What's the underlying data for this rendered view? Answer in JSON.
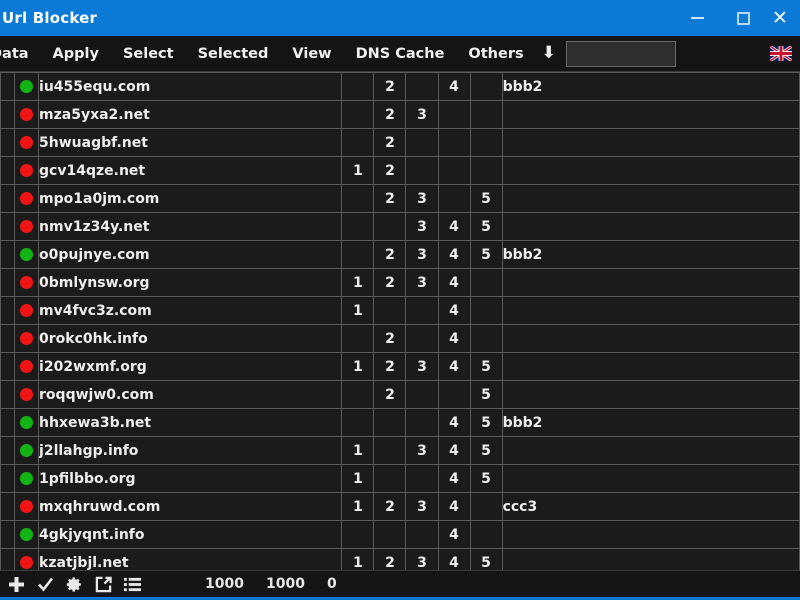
{
  "window": {
    "title": "Url Blocker",
    "controls": {
      "minimize": "—",
      "maximize": "□",
      "close": "✕"
    }
  },
  "menubar": {
    "items": [
      {
        "label": "Data"
      },
      {
        "label": "Apply"
      },
      {
        "label": "Select"
      },
      {
        "label": "Selected"
      },
      {
        "label": "View"
      },
      {
        "label": "DNS Cache"
      },
      {
        "label": "Others"
      }
    ],
    "arrow": "⬇",
    "search": {
      "value": "",
      "placeholder": ""
    },
    "flag_icon": "uk-flag-icon"
  },
  "table": {
    "columns": [
      "status",
      "domain",
      "col1",
      "col2",
      "col3",
      "col4",
      "col5",
      "tag"
    ],
    "rows": [
      {
        "status": "green",
        "domain": "iu455equ.com",
        "c1": "",
        "c2": "2",
        "c3": "",
        "c4": "4",
        "c5": "",
        "tag": "bbb2"
      },
      {
        "status": "red",
        "domain": "mza5yxa2.net",
        "c1": "",
        "c2": "2",
        "c3": "3",
        "c4": "",
        "c5": "",
        "tag": ""
      },
      {
        "status": "red",
        "domain": "5hwuagbf.net",
        "c1": "",
        "c2": "2",
        "c3": "",
        "c4": "",
        "c5": "",
        "tag": ""
      },
      {
        "status": "red",
        "domain": "gcv14qze.net",
        "c1": "1",
        "c2": "2",
        "c3": "",
        "c4": "",
        "c5": "",
        "tag": ""
      },
      {
        "status": "red",
        "domain": "mpo1a0jm.com",
        "c1": "",
        "c2": "2",
        "c3": "3",
        "c4": "",
        "c5": "5",
        "tag": ""
      },
      {
        "status": "red",
        "domain": "nmv1z34y.net",
        "c1": "",
        "c2": "",
        "c3": "3",
        "c4": "4",
        "c5": "5",
        "tag": ""
      },
      {
        "status": "green",
        "domain": "o0pujnye.com",
        "c1": "",
        "c2": "2",
        "c3": "3",
        "c4": "4",
        "c5": "5",
        "tag": "bbb2"
      },
      {
        "status": "red",
        "domain": "0bmlynsw.org",
        "c1": "1",
        "c2": "2",
        "c3": "3",
        "c4": "4",
        "c5": "",
        "tag": ""
      },
      {
        "status": "red",
        "domain": "mv4fvc3z.com",
        "c1": "1",
        "c2": "",
        "c3": "",
        "c4": "4",
        "c5": "",
        "tag": ""
      },
      {
        "status": "red",
        "domain": "0rokc0hk.info",
        "c1": "",
        "c2": "2",
        "c3": "",
        "c4": "4",
        "c5": "",
        "tag": ""
      },
      {
        "status": "red",
        "domain": "i202wxmf.org",
        "c1": "1",
        "c2": "2",
        "c3": "3",
        "c4": "4",
        "c5": "5",
        "tag": ""
      },
      {
        "status": "red",
        "domain": "roqqwjw0.com",
        "c1": "",
        "c2": "2",
        "c3": "",
        "c4": "",
        "c5": "5",
        "tag": ""
      },
      {
        "status": "green",
        "domain": "hhxewa3b.net",
        "c1": "",
        "c2": "",
        "c3": "",
        "c4": "4",
        "c5": "5",
        "tag": "bbb2"
      },
      {
        "status": "green",
        "domain": "j2llahgp.info",
        "c1": "1",
        "c2": "",
        "c3": "3",
        "c4": "4",
        "c5": "5",
        "tag": ""
      },
      {
        "status": "green",
        "domain": "1pfilbbo.org",
        "c1": "1",
        "c2": "",
        "c3": "",
        "c4": "4",
        "c5": "5",
        "tag": ""
      },
      {
        "status": "red",
        "domain": "mxqhruwd.com",
        "c1": "1",
        "c2": "2",
        "c3": "3",
        "c4": "4",
        "c5": "",
        "tag": "ccc3"
      },
      {
        "status": "green",
        "domain": "4gkjyqnt.info",
        "c1": "",
        "c2": "",
        "c3": "",
        "c4": "4",
        "c5": "",
        "tag": ""
      },
      {
        "status": "red",
        "domain": "kzatjbjl.net",
        "c1": "1",
        "c2": "2",
        "c3": "3",
        "c4": "4",
        "c5": "5",
        "tag": ""
      }
    ]
  },
  "statusbar": {
    "icons": [
      "plus-icon",
      "check-icon",
      "gear-icon",
      "export-icon",
      "list-icon"
    ],
    "counters": [
      "1000",
      "1000",
      "0"
    ]
  },
  "colors": {
    "titlebar": "#0b7ad6",
    "status_green": "#12b312",
    "status_red": "#f01414",
    "grid_line": "#5a5a5a",
    "background": "#1b1b1b"
  }
}
